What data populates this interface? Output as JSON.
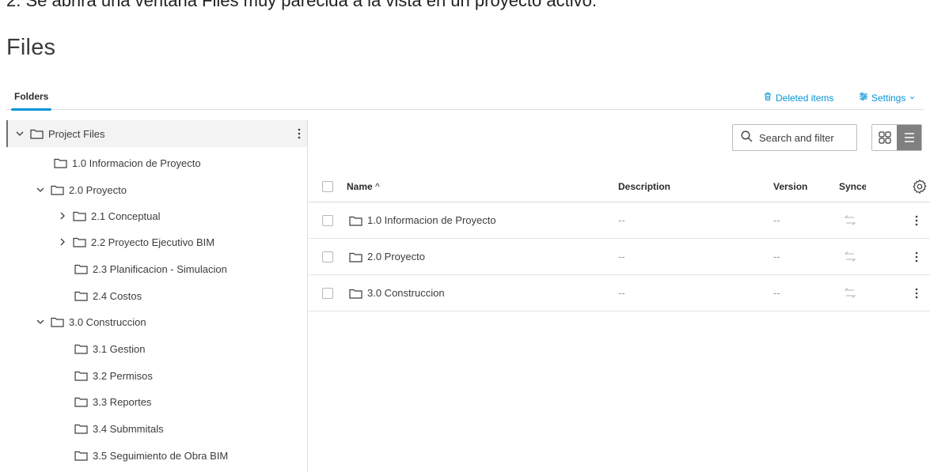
{
  "caption": "2. Se abrirá una ventana Files muy parecida a la vista en un proyecto activo.",
  "page_title": "Files",
  "tabs": {
    "folders": "Folders"
  },
  "actions": {
    "deleted_items": "Deleted items",
    "settings": "Settings"
  },
  "tree": [
    {
      "label": "Project Files",
      "expand": "expanded",
      "selected": true
    },
    {
      "label": "1.0 Informacion de Proyecto",
      "expand": "none"
    },
    {
      "label": "2.0 Proyecto",
      "expand": "expanded"
    },
    {
      "label": "2.1 Conceptual",
      "expand": "collapsed"
    },
    {
      "label": "2.2 Proyecto Ejecutivo BIM",
      "expand": "collapsed"
    },
    {
      "label": "2.3 Planificacion - Simulacion",
      "expand": "none"
    },
    {
      "label": "2.4 Costos",
      "expand": "none"
    },
    {
      "label": "3.0 Construccion",
      "expand": "expanded"
    },
    {
      "label": "3.1 Gestion",
      "expand": "none"
    },
    {
      "label": "3.2 Permisos",
      "expand": "none"
    },
    {
      "label": "3.3 Reportes",
      "expand": "none"
    },
    {
      "label": "3.4 Submmitals",
      "expand": "none"
    },
    {
      "label": "3.5 Seguimiento de Obra BIM",
      "expand": "none"
    }
  ],
  "search": {
    "placeholder": "Search and filter"
  },
  "table": {
    "columns": {
      "name": "Name",
      "sort_indicator": "^",
      "description": "Description",
      "version": "Version",
      "sync": "Synce"
    },
    "rows": [
      {
        "name": "1.0 Informacion de Proyecto",
        "description": "--",
        "version": "--"
      },
      {
        "name": "2.0 Proyecto",
        "description": "--",
        "version": "--"
      },
      {
        "name": "3.0 Construccion",
        "description": "--",
        "version": "--"
      }
    ]
  },
  "colors": {
    "accent": "#0696d7",
    "active_toggle": "#808080",
    "selected_row": "#f3f3f3"
  }
}
